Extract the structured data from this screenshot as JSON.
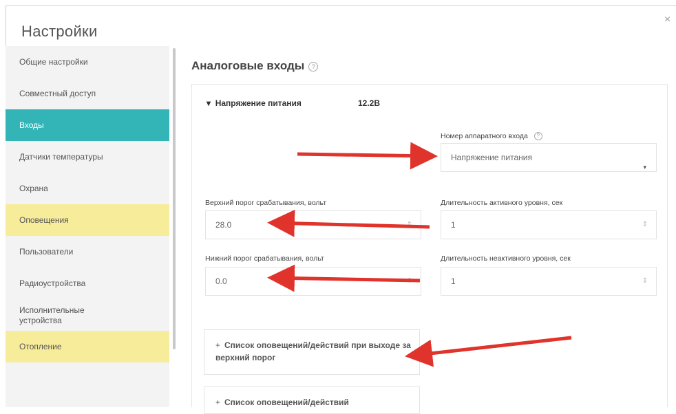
{
  "window": {
    "title": "Настройки",
    "close_label": "×"
  },
  "sidebar": {
    "items": [
      {
        "label": "Общие настройки"
      },
      {
        "label": "Совместный доступ"
      },
      {
        "label": "Входы"
      },
      {
        "label": "Датчики температуры"
      },
      {
        "label": "Охрана"
      },
      {
        "label": "Оповещения"
      },
      {
        "label": "Пользователи"
      },
      {
        "label": "Радиоустройства"
      },
      {
        "label": "Исполнительные устройства"
      },
      {
        "label": "Отопление"
      }
    ]
  },
  "content": {
    "title": "Аналоговые входы",
    "help_glyph": "?",
    "section": {
      "toggle": "▾",
      "label": "Напряжение питания",
      "value": "12.2В"
    },
    "hw_input": {
      "label": "Номер аппаратного входа",
      "help_glyph": "?",
      "selected": "Напряжение питания",
      "caret": "▾"
    },
    "upper_threshold": {
      "label": "Верхний порог срабатывания, вольт",
      "value": "28.0"
    },
    "lower_threshold": {
      "label": "Нижний порог срабатывания, вольт",
      "value": "0.0"
    },
    "active_duration": {
      "label": "Длительность активного уровня, сек",
      "value": "1"
    },
    "inactive_duration": {
      "label": "Длительность неактивного уровня, сек",
      "value": "1"
    },
    "spin_glyph": "⇕",
    "actions_upper": {
      "plus": "+",
      "label": "Список оповещений/действий при выходе за верхний порог"
    },
    "actions_lower": {
      "plus": "+",
      "label": "Список оповещений/действий"
    }
  },
  "colors": {
    "accent": "#33b5b8",
    "highlight": "#f7ec9a",
    "arrow": "#e0332b"
  }
}
